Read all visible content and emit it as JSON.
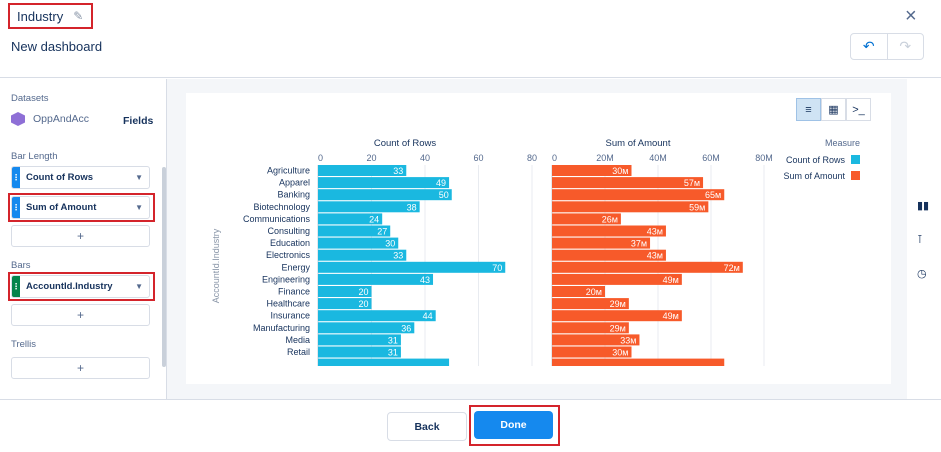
{
  "header": {
    "title": "Industry",
    "subtitle": "New dashboard",
    "close_symbol": "×",
    "undo_symbol": "↶",
    "redo_symbol": "↷"
  },
  "left_panel": {
    "datasets_label": "Datasets",
    "dataset_name": "OppAndAcc",
    "fields_label": "Fields",
    "bar_length_label": "Bar Length",
    "bar_length_fields": [
      "Count of Rows",
      "Sum of Amount"
    ],
    "bars_label": "Bars",
    "bars_field": "AccountId.Industry",
    "trellis_label": "Trellis",
    "add_symbol": "+"
  },
  "footer": {
    "back_label": "Back",
    "done_label": "Done"
  },
  "colors": {
    "count_series": "#1ab8e0",
    "amount_series": "#f75a2a",
    "highlight": "#d4242b",
    "primary_button": "#1589ee"
  },
  "chart_data": {
    "type": "bar",
    "orientation": "horizontal",
    "y_axis_label": "AccountId.Industry",
    "legend_title": "Measure",
    "legend_position": "top-right",
    "categories": [
      "Agriculture",
      "Apparel",
      "Banking",
      "Biotechnology",
      "Communications",
      "Consulting",
      "Education",
      "Electronics",
      "Energy",
      "Engineering",
      "Finance",
      "Healthcare",
      "Insurance",
      "Manufacturing",
      "Media",
      "Retail"
    ],
    "series": [
      {
        "name": "Count of Rows",
        "values": [
          33,
          49,
          50,
          38,
          24,
          27,
          30,
          33,
          70,
          43,
          20,
          20,
          44,
          36,
          31,
          31
        ],
        "labels": [
          "33",
          "49",
          "50",
          "38",
          "24",
          "27",
          "30",
          "33",
          "70",
          "43",
          "20",
          "20",
          "44",
          "36",
          "31",
          "31"
        ],
        "ticks": [
          "0",
          "20",
          "40",
          "60",
          "80"
        ],
        "xlim": [
          0,
          80
        ]
      },
      {
        "name": "Sum of Amount",
        "values": [
          30,
          57,
          65,
          59,
          26,
          43,
          37,
          43,
          72,
          49,
          20,
          29,
          49,
          29,
          33,
          30
        ],
        "labels": [
          "30м",
          "57м",
          "65м",
          "59м",
          "26м",
          "43м",
          "37м",
          "43м",
          "72м",
          "49м",
          "20м",
          "29м",
          "49м",
          "29м",
          "33м",
          "30м"
        ],
        "ticks": [
          "0",
          "20M",
          "40M",
          "60M",
          "80M"
        ],
        "xlim": [
          0,
          80
        ]
      }
    ],
    "partial_next_row": {
      "count_value": 49,
      "amount_value": 65
    }
  }
}
